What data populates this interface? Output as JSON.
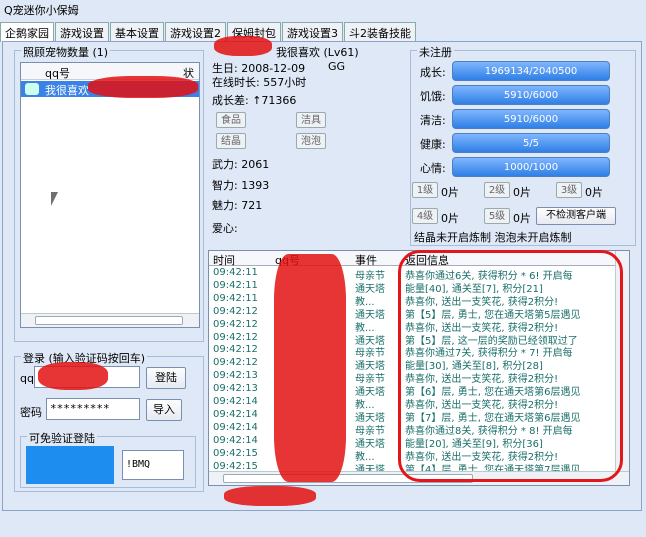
{
  "window": {
    "title": "Q宠迷你小保姆"
  },
  "tabs": [
    "企鹅家园",
    "游戏设置",
    "基本设置",
    "游戏设置2",
    "保姆封包",
    "游戏设置3",
    "斗2装备技能"
  ],
  "pet_list": {
    "title": "照顾宠物数量 (1)",
    "col_qq": "qq号",
    "col_status": "状",
    "row1_name": "我很喜欢"
  },
  "pet_info": {
    "pet_name": "我很喜欢 (Lv61)",
    "birth": "生日: 2008-12-09",
    "gender": "GG",
    "online": "在线时长: 557小时",
    "growth_diff": "成长差: ↑71366",
    "food_btn": "食品",
    "tool_btn": "洁具",
    "crystal_btn": "结晶",
    "bubble_btn": "泡泡",
    "force": "武力: 2061",
    "intelligence": "智力: 1393",
    "charm": "魅力: 721",
    "love": "爱心:"
  },
  "register": {
    "title": "未注册",
    "growth_label": "成长:",
    "growth_val": "1969134/2040500",
    "hunger_label": "饥饿:",
    "hunger_val": "5910/6000",
    "clean_label": "清洁:",
    "clean_val": "5910/6000",
    "health_label": "健康:",
    "health_val": "5/5",
    "mood_label": "心情:",
    "mood_val": "1000/1000",
    "lv1": "1级",
    "lv1_cnt": "0片",
    "lv2": "2级",
    "lv2_cnt": "0片",
    "lv3": "3级",
    "lv3_cnt": "0片",
    "lv4": "4级",
    "lv4_cnt": "0片",
    "lv5": "5级",
    "lv5_cnt": "0片",
    "no_check_btn": "不检测客户端",
    "note": "结晶未开启炼制 泡泡未开启炼制"
  },
  "login": {
    "title": "登录 (输入验证码按回车)",
    "qq_label": "qq",
    "login_btn": "登陆",
    "pwd_label": "密码",
    "pwd_val": "*********",
    "import_btn": "导入",
    "captcha_title": "可免验证登陆",
    "captcha_text": "!BMQ"
  },
  "log": {
    "col_time": "时间",
    "col_qq": "qq号",
    "col_event": "事件",
    "col_msg": "返回信息",
    "rows": [
      {
        "time": "09:42:11",
        "event": "母亲节",
        "msg": "恭喜你通过6关, 获得积分 * 6! 开启每"
      },
      {
        "time": "09:42:11",
        "event": "通天塔",
        "msg": "能量[40], 通关至[7], 积分[21]"
      },
      {
        "time": "09:42:11",
        "event": "教...",
        "msg": "恭喜你, 送出一支笑花, 获得2积分!"
      },
      {
        "time": "09:42:12",
        "event": "通天塔",
        "msg": "第【5】层, 勇士, 您在通天塔第5层遇见"
      },
      {
        "time": "09:42:12",
        "event": "教...",
        "msg": "恭喜你, 送出一支笑花, 获得2积分!"
      },
      {
        "time": "09:42:12",
        "event": "通天塔",
        "msg": "第【5】层, 这一层的奖励已经领取过了"
      },
      {
        "time": "09:42:12",
        "event": "母亲节",
        "msg": "恭喜你通过7关, 获得积分 * 7! 开启每"
      },
      {
        "time": "09:42:12",
        "event": "通天塔",
        "msg": "能量[30], 通关至[8], 积分[28]"
      },
      {
        "time": "09:42:13",
        "event": "母亲节",
        "msg": "恭喜你, 送出一支笑花, 获得2积分!"
      },
      {
        "time": "09:42:13",
        "event": "通天塔",
        "msg": "第【6】层, 勇士, 您在通天塔第6层遇见"
      },
      {
        "time": "09:42:14",
        "event": "教...",
        "msg": "恭喜你, 送出一支笑花, 获得2积分!"
      },
      {
        "time": "09:42:14",
        "event": "通天塔",
        "msg": "第【7】层, 勇士, 您在通天塔第6层遇见"
      },
      {
        "time": "09:42:14",
        "event": "母亲节",
        "msg": "恭喜你通过8关, 获得积分 * 8! 开启每"
      },
      {
        "time": "09:42:14",
        "event": "通天塔",
        "msg": "能量[20], 通关至[9], 积分[36]"
      },
      {
        "time": "09:42:15",
        "event": "教...",
        "msg": "恭喜你, 送出一支笑花, 获得2积分!"
      },
      {
        "time": "09:42:15",
        "event": "通天塔",
        "msg": "第【4】层, 勇士, 您在通天塔第7层遇见"
      }
    ]
  }
}
